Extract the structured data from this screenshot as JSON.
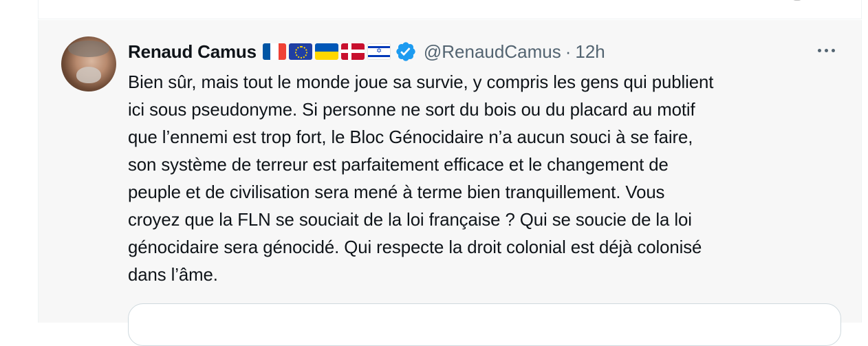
{
  "tweet": {
    "display_name": "Renaud Camus",
    "flags": [
      "🇫🇷",
      "🇪🇺",
      "🇺🇦",
      "🇩🇰",
      "🇮🇱"
    ],
    "handle": "@RenaudCamus",
    "separator": "·",
    "time": "12h",
    "verified_icon": "verified-badge-icon",
    "more_icon": "more-horizontal-icon",
    "text_lines": [
      "Bien sûr, mais tout le monde joue sa survie, y compris les gens qui publient",
      "ici sous pseudonyme. Si personne ne sort du bois ou du placard au motif",
      "que l’ennemi est trop fort, le Bloc Génocidaire n’a aucun souci à se faire,",
      "son système de terreur est parfaitement efficace et le changement de",
      "peuple et de civilisation sera mené à terme bien tranquillement. Vous",
      "croyez que la FLN se souciait de la loi française ? Qui se soucie de la loi",
      "génocidaire sera génocidé. Qui respecte la droit colonial est déjà colonisé",
      "dans l’âme."
    ]
  },
  "colors": {
    "text": "#0f1419",
    "secondary": "#536471",
    "verified": "#1d9bf0",
    "tweet_bg": "#f7f7f7",
    "border": "#cfd9de"
  }
}
